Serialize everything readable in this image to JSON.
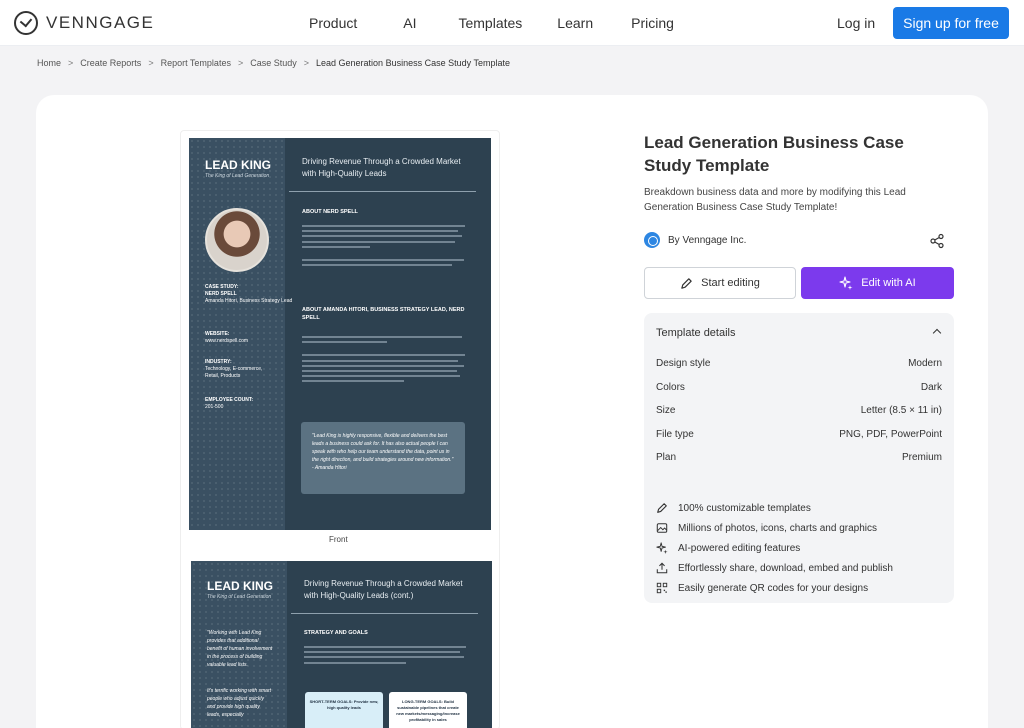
{
  "header": {
    "logo": "VENNGAGE",
    "nav": [
      "Product",
      "AI",
      "Templates",
      "Learn",
      "Pricing"
    ],
    "login": "Log in",
    "signup": "Sign up for free"
  },
  "breadcrumb": [
    "Home",
    "Create Reports",
    "Report Templates",
    "Case Study",
    "Lead Generation Business Case Study Template"
  ],
  "preview": {
    "front_label": "Front",
    "page1": {
      "brand": "LEAD KING",
      "tagline": "The King of Lead Generation",
      "headline": "Driving Revenue Through a Crowded Market with High-Quality Leads",
      "section1": "ABOUT NERD SPELL",
      "section2": "ABOUT AMANDA HITORI, BUSINESS STRATEGY LEAD, NERD SPELL",
      "case_study": "CASE STUDY:",
      "case_name": "NERD SPELL",
      "case_person": "Amanda Hitori, Business Strategy Lead",
      "website_label": "WEBSITE:",
      "website": "www.nerdspell.com",
      "industry_label": "INDUSTRY:",
      "industry": "Technology, E-commerce, Retail, Products",
      "employee_label": "EMPLOYEE COUNT:",
      "employee": "201-500",
      "quote": "\"Lead King is highly responsive, flexible and delivers the best leads a business could ask for. It has also actual people I can speak with who help our team understand the data, point us in the right direction, and build strategies around new information.\" - Amanda Hitori"
    },
    "page2": {
      "brand": "LEAD KING",
      "tagline": "The King of Lead Generation",
      "headline": "Driving Revenue Through a Crowded Market with High-Quality Leads (cont.)",
      "section": "STRATEGY AND GOALS",
      "side_quote1": "\"Working with Lead King provides that additional benefit of human involvement in the process of building valuable lead lists.",
      "side_quote2": "It's terrific working with smart people who adjust quickly and provide high quality leads, especially",
      "goal_short": "SHORT-TERM GOALS: Provide new, high quality leads",
      "goal_long": "LONG-TERM GOALS: Build sustainable pipelines that create new markets/messaging/increase profitability in sales"
    }
  },
  "template": {
    "title": "Lead Generation Business Case Study Template",
    "description": "Breakdown business data and more by modifying this Lead Generation Business Case Study Template!",
    "author": "By Venngage Inc.",
    "start_editing": "Start editing",
    "edit_ai": "Edit with AI"
  },
  "details": {
    "title": "Template details",
    "rows": [
      {
        "label": "Design style",
        "value": "Modern"
      },
      {
        "label": "Colors",
        "value": "Dark"
      },
      {
        "label": "Size",
        "value": "Letter (8.5 × 11 in)"
      },
      {
        "label": "File type",
        "value": "PNG, PDF, PowerPoint"
      },
      {
        "label": "Plan",
        "value": "Premium"
      }
    ],
    "features": [
      "100% customizable templates",
      "Millions of photos, icons, charts and graphics",
      "AI-powered editing features",
      "Effortlessly share, download, embed and publish",
      "Easily generate QR codes for your designs"
    ]
  },
  "colors": {
    "accent": "#1a7ae6",
    "ai": "#7c3aed",
    "page": "#2d4150"
  }
}
